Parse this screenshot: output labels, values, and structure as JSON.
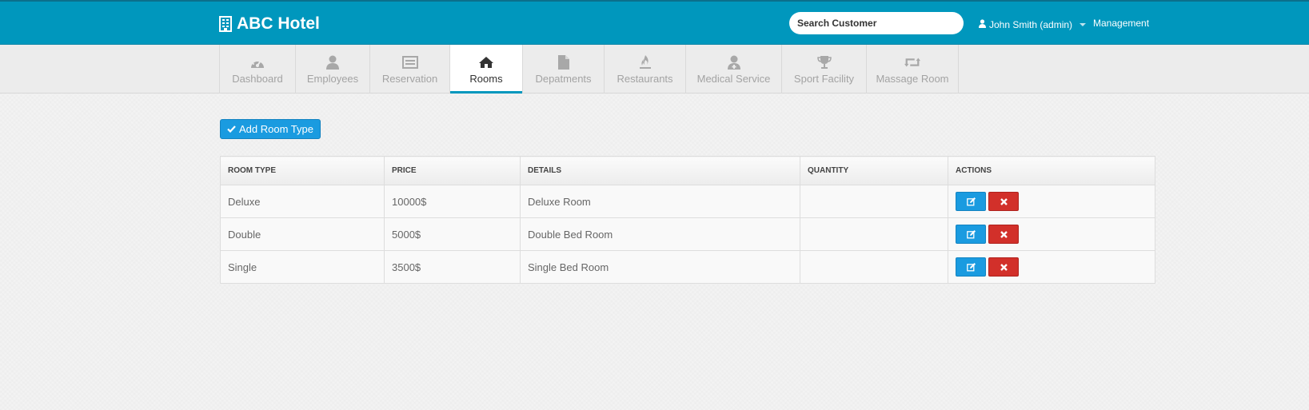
{
  "header": {
    "brand": "ABC Hotel",
    "brand_icon": "building-icon",
    "search_placeholder": "Search Customer",
    "user": "John Smith (admin)",
    "user_icon": "user-icon",
    "management": "Management"
  },
  "nav": {
    "tabs": [
      {
        "label": "Dashboard",
        "icon": "dashboard-icon"
      },
      {
        "label": "Employees",
        "icon": "user-icon"
      },
      {
        "label": "Reservation",
        "icon": "list-card-icon"
      },
      {
        "label": "Rooms",
        "icon": "home-icon",
        "active": true
      },
      {
        "label": "Depatments",
        "icon": "document-icon"
      },
      {
        "label": "Restaurants",
        "icon": "fire-icon"
      },
      {
        "label": "Medical Service",
        "icon": "doctor-icon"
      },
      {
        "label": "Sport Facility",
        "icon": "trophy-icon"
      },
      {
        "label": "Massage Room",
        "icon": "retweet-icon"
      }
    ]
  },
  "main": {
    "add_button": "Add Room Type",
    "table": {
      "headers": [
        "ROOM TYPE",
        "PRICE",
        "DETAILS",
        "QUANTITY",
        "ACTIONS"
      ],
      "rows": [
        {
          "type": "Deluxe",
          "price": "10000$",
          "details": "Deluxe Room",
          "quantity": ""
        },
        {
          "type": "Double",
          "price": "5000$",
          "details": "Double Bed Room",
          "quantity": ""
        },
        {
          "type": "Single",
          "price": "3500$",
          "details": "Single Bed Room",
          "quantity": ""
        }
      ]
    }
  },
  "colors": {
    "header_bg": "#0097bd",
    "primary_button": "#1a9be0",
    "danger_button": "#d2302a"
  }
}
